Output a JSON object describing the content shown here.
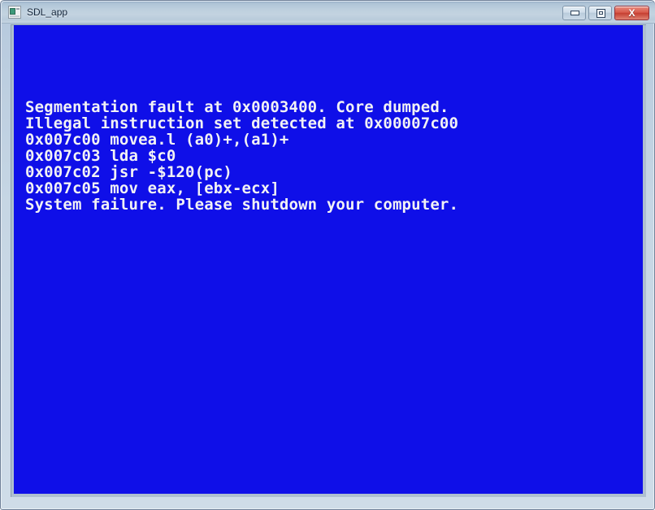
{
  "window": {
    "title": "SDL_app",
    "icon": "sdl-app-icon",
    "controls": {
      "minimize_label": "",
      "maximize_label": "",
      "close_label": "X"
    },
    "colors": {
      "canvas_background": "#0f0fe8",
      "canvas_text": "#f2f2f5",
      "titlebar": "#bed0de",
      "close_button": "#c53f32",
      "frame_border": "#6f8199"
    }
  },
  "console": {
    "lines": [
      "Segmentation fault at 0x0003400. Core dumped.",
      "Illegal instruction set detected at 0x00007c00",
      "0x007c00 movea.l (a0)+,(a1)+",
      "0x007c03 lda $c0",
      "0x007c02 jsr -$120(pc)",
      "0x007c05 mov eax, [ebx-ecx]",
      "System failure. Please shutdown your computer."
    ]
  }
}
